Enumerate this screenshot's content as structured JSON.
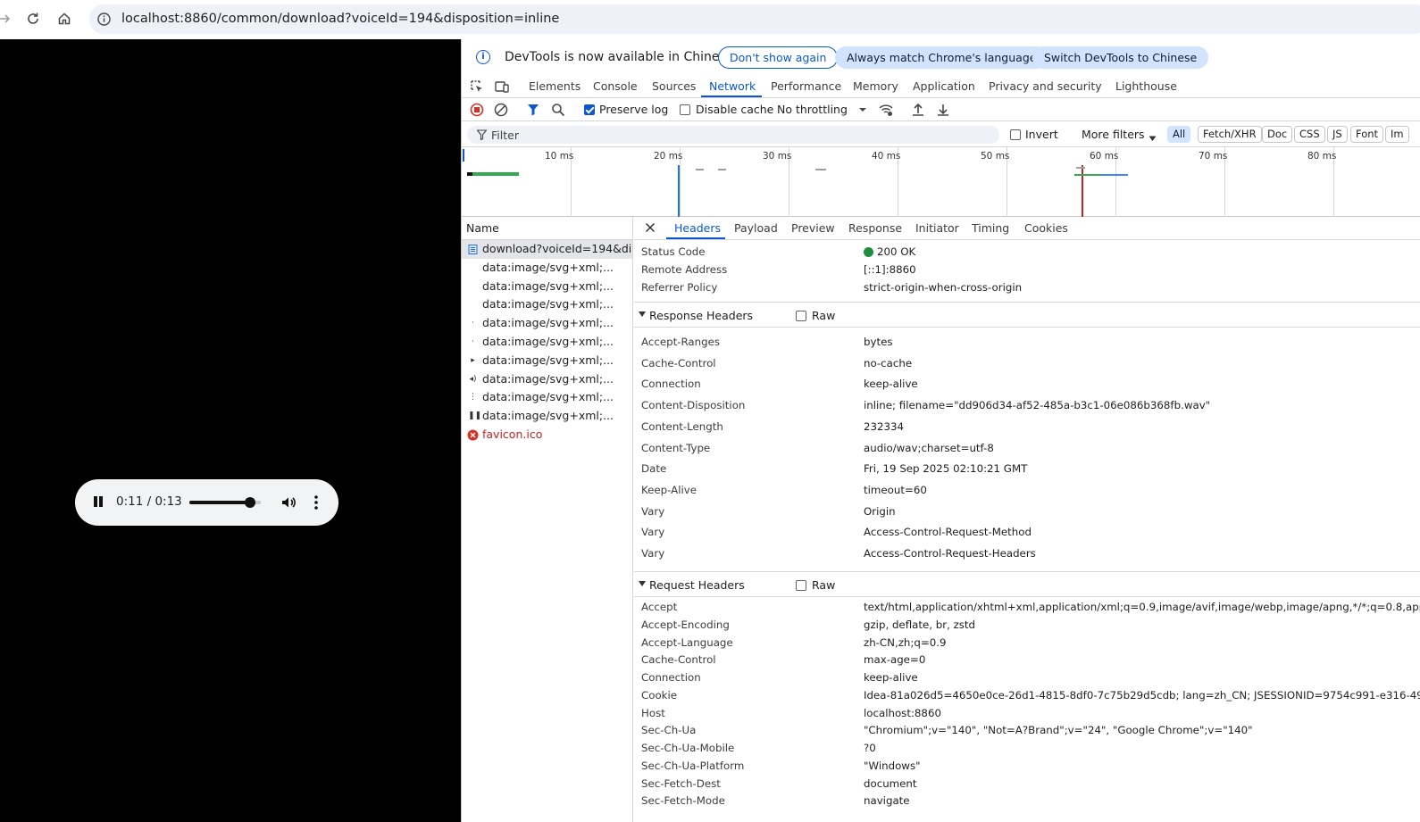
{
  "browser": {
    "url": "localhost:8860/common/download?voiceId=194&disposition=inline"
  },
  "player": {
    "time": "0:11 / 0:13",
    "progress": 0.846
  },
  "devtools": {
    "infobar": {
      "message": "DevTools is now available in Chinese",
      "dont_show": "Don't show again",
      "always_match": "Always match Chrome's language",
      "switch": "Switch DevTools to Chinese"
    },
    "tabs": [
      "Elements",
      "Console",
      "Sources",
      "Network",
      "Performance",
      "Memory",
      "Application",
      "Privacy and security",
      "Lighthouse"
    ],
    "active_tab": "Network",
    "toolbar": {
      "preserve_log": "Preserve log",
      "disable_cache": "Disable cache",
      "throttling": "No throttling"
    },
    "filter": {
      "placeholder": "Filter",
      "invert": "Invert",
      "more_filters": "More filters",
      "types": [
        "All",
        "Fetch/XHR",
        "Doc",
        "CSS",
        "JS",
        "Font",
        "Im"
      ]
    },
    "overview": {
      "ticks": [
        "10 ms",
        "20 ms",
        "30 ms",
        "40 ms",
        "50 ms",
        "60 ms",
        "70 ms",
        "80 ms"
      ]
    },
    "requests": {
      "header": "Name",
      "rows": [
        "download?voiceId=194&di...",
        "data:image/svg+xml;...",
        "data:image/svg+xml;...",
        "data:image/svg+xml;...",
        "data:image/svg+xml;...",
        "data:image/svg+xml;...",
        "data:image/svg+xml;...",
        "data:image/svg+xml;...",
        "data:image/svg+xml;...",
        "data:image/svg+xml;...",
        "favicon.ico"
      ]
    },
    "details": {
      "tabs": [
        "Headers",
        "Payload",
        "Preview",
        "Response",
        "Initiator",
        "Timing",
        "Cookies"
      ],
      "general": [
        {
          "k": "Status Code",
          "v": "200 OK"
        },
        {
          "k": "Remote Address",
          "v": "[::1]:8860"
        },
        {
          "k": "Referrer Policy",
          "v": "strict-origin-when-cross-origin"
        }
      ],
      "response_title": "Response Headers",
      "raw_label": "Raw",
      "response_headers": [
        {
          "k": "Accept-Ranges",
          "v": "bytes"
        },
        {
          "k": "Cache-Control",
          "v": "no-cache"
        },
        {
          "k": "Connection",
          "v": "keep-alive"
        },
        {
          "k": "Content-Disposition",
          "v": "inline; filename=\"dd906d34-af52-485a-b3c1-06e086b368fb.wav\""
        },
        {
          "k": "Content-Length",
          "v": "232334"
        },
        {
          "k": "Content-Type",
          "v": "audio/wav;charset=utf-8"
        },
        {
          "k": "Date",
          "v": "Fri, 19 Sep 2025 02:10:21 GMT"
        },
        {
          "k": "Keep-Alive",
          "v": "timeout=60"
        },
        {
          "k": "Vary",
          "v": "Origin"
        },
        {
          "k": "Vary",
          "v": "Access-Control-Request-Method"
        },
        {
          "k": "Vary",
          "v": "Access-Control-Request-Headers"
        }
      ],
      "request_title": "Request Headers",
      "request_headers": [
        {
          "k": "Accept",
          "v": "text/html,application/xhtml+xml,application/xml;q=0.9,image/avif,image/webp,image/apng,*/*;q=0.8,appl"
        },
        {
          "k": "Accept-Encoding",
          "v": "gzip, deflate, br, zstd"
        },
        {
          "k": "Accept-Language",
          "v": "zh-CN,zh;q=0.9"
        },
        {
          "k": "Cache-Control",
          "v": "max-age=0"
        },
        {
          "k": "Connection",
          "v": "keep-alive"
        },
        {
          "k": "Cookie",
          "v": "Idea-81a026d5=4650e0ce-26d1-4815-8df0-7c75b29d5cdb; lang=zh_CN; JSESSIONID=9754c991-e316-49c"
        },
        {
          "k": "Host",
          "v": "localhost:8860"
        },
        {
          "k": "Sec-Ch-Ua",
          "v": "\"Chromium\";v=\"140\", \"Not=A?Brand\";v=\"24\", \"Google Chrome\";v=\"140\""
        },
        {
          "k": "Sec-Ch-Ua-Mobile",
          "v": "?0"
        },
        {
          "k": "Sec-Ch-Ua-Platform",
          "v": "\"Windows\""
        },
        {
          "k": "Sec-Fetch-Dest",
          "v": "document"
        },
        {
          "k": "Sec-Fetch-Mode",
          "v": "navigate"
        }
      ]
    }
  }
}
